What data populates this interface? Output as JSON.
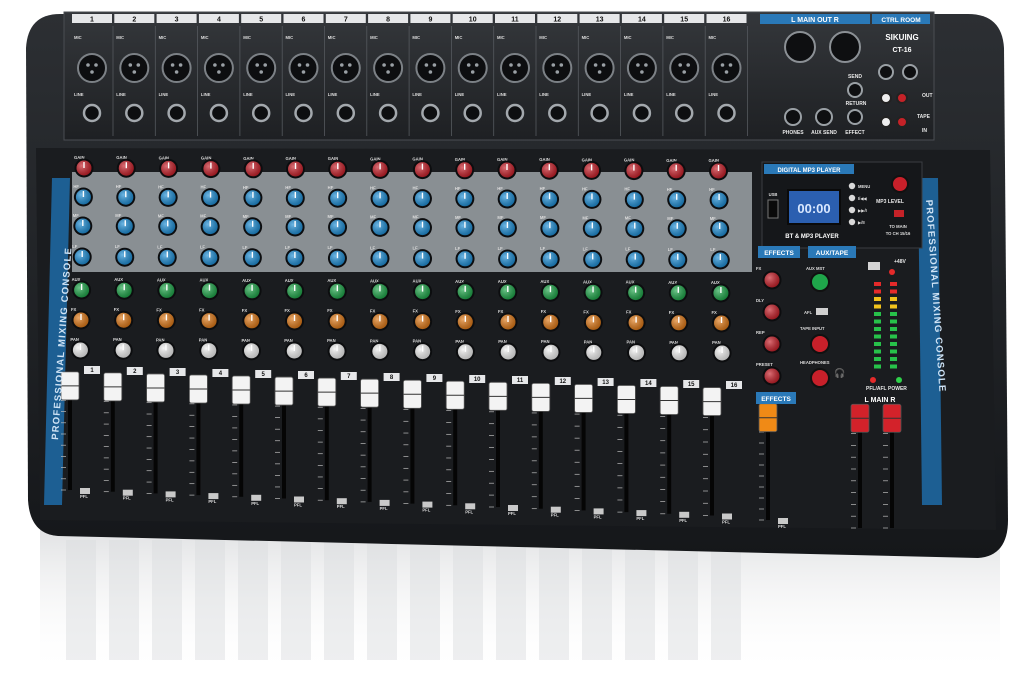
{
  "brand": {
    "name": "SIKUING",
    "model": "CT-16"
  },
  "side_label": "PROFESSIONAL MIXING CONSOLE",
  "channel_numbers": [
    "1",
    "2",
    "3",
    "4",
    "5",
    "6",
    "7",
    "8",
    "9",
    "10",
    "11",
    "12",
    "13",
    "14",
    "15",
    "16"
  ],
  "input_labels": {
    "mic": "MIC",
    "line": "LINE"
  },
  "header_sections": {
    "main_out": "L  MAIN OUT  R",
    "ctrl_room": "CTRL ROOM"
  },
  "rear_labels": {
    "phones": "PHONES",
    "aux_send": "AUX SEND",
    "effect": "EFFECT",
    "send": "SEND",
    "return": "RETURN",
    "out": "OUT",
    "tape": "TAPE",
    "in": "IN",
    "l": "L",
    "r": "R"
  },
  "knob_rows": [
    {
      "label": "GAIN",
      "color": "#c8202a"
    },
    {
      "label": "HF",
      "color": "#1f8fd6"
    },
    {
      "label": "MF",
      "color": "#1f8fd6"
    },
    {
      "label": "LF",
      "color": "#1f8fd6"
    },
    {
      "label": "AUX",
      "color": "#1fa64a"
    },
    {
      "label": "FX",
      "color": "#e07a18"
    },
    {
      "label": "PAN",
      "color": "#f2f2f2"
    }
  ],
  "mp3_player": {
    "title": "DIGITAL MP3 PLAYER",
    "display": "00:00",
    "usb": "USB",
    "bt": "BT & MP3 PLAYER",
    "menu": "MENU",
    "mp3_level": "MP3 LEVEL",
    "to_main": "TO MAIN",
    "to_ch": "TO CH 15/16"
  },
  "effects": {
    "title": "EFFECTS",
    "knobs": [
      "FX",
      "DLY",
      "REP",
      "PRESET"
    ],
    "fader_label": "EFFECTS"
  },
  "aux_tape": {
    "title": "AUX/TAPE",
    "aux_mst": "AUX MST",
    "afl": "AFL",
    "tape_input": "TAPE INPUT",
    "headphones": "HEADPHONES"
  },
  "meter": {
    "phantom": "+48V",
    "pfl_afl": "PFL/AFL",
    "power": "POWER"
  },
  "main_fader_label": "L  MAIN  R",
  "pfl": "PFL",
  "colors": {
    "body": "#1b1d20",
    "panel": "#24272b",
    "accent": "#2a79b8",
    "silver": "#b9bdc2"
  },
  "fader_positions": [
    0.93,
    0.93,
    0.93,
    0.93,
    0.93,
    0.93,
    0.93,
    0.93,
    0.93,
    0.93,
    0.93,
    0.93,
    0.93,
    0.93,
    0.93,
    0.93
  ]
}
